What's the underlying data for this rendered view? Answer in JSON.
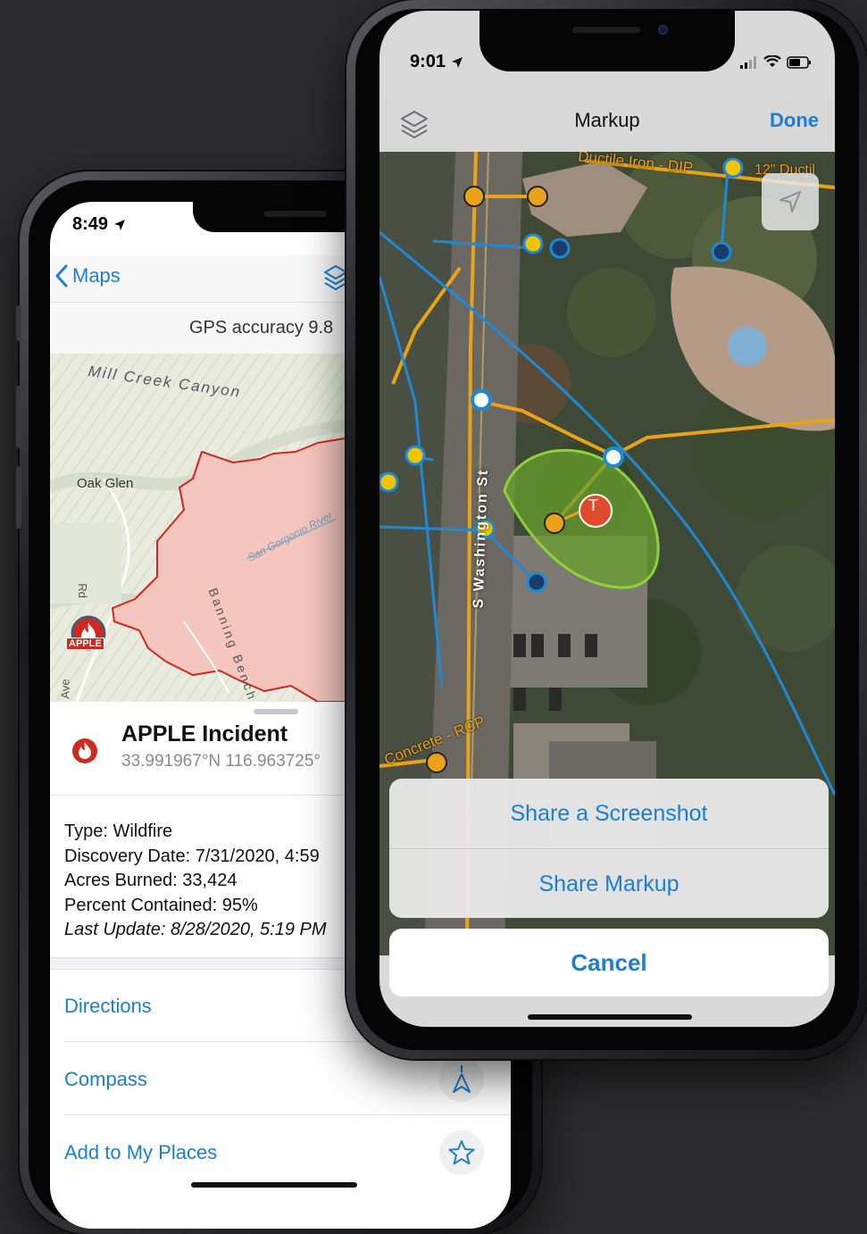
{
  "left_phone": {
    "status_time": "8:49",
    "nav": {
      "back_label": "Maps"
    },
    "gps_accuracy": "GPS accuracy 9.8",
    "map_labels": {
      "mill_creek": "Mill Creek Canyon",
      "oak_glen": "Oak Glen",
      "san_gorgonio": "San Gorgonio River",
      "banning": "Banning Bench",
      "rd": "Rd",
      "ave": "Ave",
      "apple_badge": "APPLE"
    },
    "incident": {
      "title": "APPLE Incident",
      "coords": "33.991967°N 116.963725°"
    },
    "attributes": {
      "type": "Type: Wildfire",
      "discovery": "Discovery Date: 7/31/2020, 4:59",
      "acres": "Acres Burned: 33,424",
      "contained": "Percent Contained: 95%",
      "last_update": "Last Update: 8/28/2020, 5:19 PM"
    },
    "actions": [
      "Directions",
      "Compass",
      "Add to My Places"
    ],
    "colors": {
      "accent": "#1a7fd3",
      "fire": "#d0281c",
      "perimeter": "#f4c6bd"
    }
  },
  "right_phone": {
    "status_time": "9:01",
    "nav": {
      "title": "Markup",
      "done_label": "Done"
    },
    "map_labels": {
      "street": "S Washington St",
      "ductile_iron": "Ductile Iron - DIP",
      "ductile_short": "12\" Ductil",
      "concrete": "Concrete - RCP",
      "markup_letter": "T"
    },
    "share_options": [
      "Share a Screenshot",
      "Share Markup"
    ],
    "cancel_label": "Cancel",
    "colors": {
      "water_line": "#1d8ad8",
      "pipe": "#e9a21a",
      "markup": "#8fd13a"
    }
  }
}
